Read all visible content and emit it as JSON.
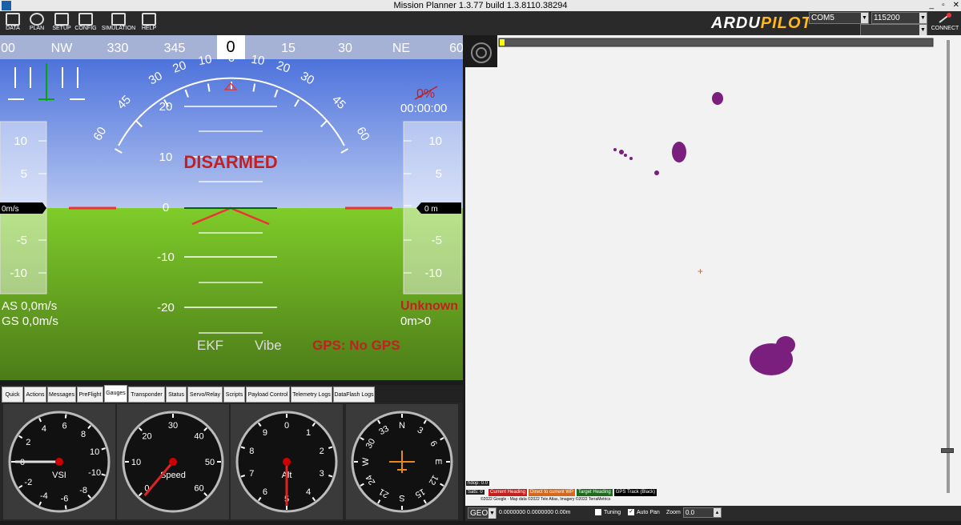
{
  "window": {
    "title": "Mission Planner 1.3.77 build 1.3.8110.38294",
    "win_buttons": [
      "_",
      "▫",
      "✕"
    ]
  },
  "menu": [
    "DATA",
    "PLAN",
    "SETUP",
    "CONFIG",
    "SIMULATION",
    "HELP"
  ],
  "logo": {
    "part1": "ARDU",
    "part2": "PILOT"
  },
  "port": "COM5",
  "baud": "115200",
  "connect_label": "CONNECT",
  "hud": {
    "compass_labels": [
      {
        "t": "00",
        "p": 10
      },
      {
        "t": "NW",
        "p": 77
      },
      {
        "t": "330",
        "p": 147
      },
      {
        "t": "345",
        "p": 218
      },
      {
        "t": "0",
        "p": 288
      },
      {
        "t": "15",
        "p": 360
      },
      {
        "t": "30",
        "p": 431
      },
      {
        "t": "NE",
        "p": 501
      },
      {
        "t": "60",
        "p": 570
      }
    ],
    "roll_labels": [
      "60",
      "45",
      "30",
      "20",
      "10",
      "0",
      "10",
      "20",
      "30",
      "45",
      "60"
    ],
    "pitch_labels": [
      "20",
      "10",
      "0",
      "-10",
      "-20"
    ],
    "status": "DISARMED",
    "battery": "0%",
    "timer": "00:00:00",
    "speed_ticks": [
      "10",
      "5",
      "0",
      "-5",
      "-10"
    ],
    "alt_ticks": [
      "10",
      "5",
      "0",
      "-5",
      "-10"
    ],
    "speed_box": "0m/s",
    "alt_box": "0 m",
    "as": "AS 0,0m/s",
    "gs": "GS 0,0m/s",
    "mode": "Unknown",
    "wp": "0m>0",
    "ekf": "EKF",
    "vibe": "Vibe",
    "gps": "GPS: No GPS"
  },
  "tabs": [
    "Quick",
    "Actions",
    "Messages",
    "PreFlight",
    "Gauges",
    "Transponder",
    "Status",
    "Servo/Relay",
    "Scripts",
    "Payload Control",
    "Telemetry Logs",
    "DataFlash Logs"
  ],
  "active_tab": "Gauges",
  "gauges": [
    {
      "label": "VSI",
      "ticks": [
        "0",
        "2",
        "4",
        "6",
        "8",
        "10",
        "-10",
        "-8",
        "-6",
        "-4",
        "-2"
      ]
    },
    {
      "label": "Speed",
      "ticks": [
        "0",
        "10",
        "20",
        "30",
        "40",
        "50",
        "60"
      ]
    },
    {
      "label": "Alt",
      "ticks": [
        "0",
        "1",
        "2",
        "3",
        "4",
        "5",
        "6",
        "7",
        "8",
        "9"
      ]
    },
    {
      "label": "",
      "ticks": [
        "N",
        "3",
        "6",
        "E",
        "12",
        "15",
        "S",
        "21",
        "24",
        "W",
        "30",
        "33"
      ]
    }
  ],
  "map": {
    "hdop": "hdop: 0.0",
    "sats": "Sats: 0",
    "legend": [
      "Current Heading",
      "Direct to current WP",
      "Target Heading",
      "GPS Track (Black)"
    ],
    "copyright": "©2022 Google - Map data ©2022 Tele Atlas, Imagery ©2022 TerraMetrics"
  },
  "mapbar": {
    "coord_type": "GEO",
    "coords": "0.0000000 0.0000000",
    "alt": "0.00m",
    "tuning": "Tuning",
    "autopan": "Auto Pan",
    "zoom_label": "Zoom",
    "zoom": "0.0"
  }
}
